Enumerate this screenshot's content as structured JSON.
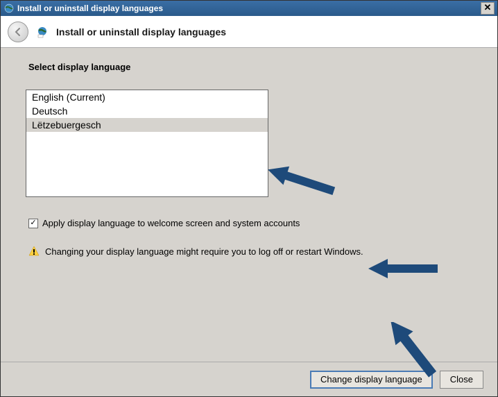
{
  "titlebar": {
    "title": "Install or uninstall display languages"
  },
  "header": {
    "title": "Install or uninstall display languages"
  },
  "content": {
    "section_title": "Select display language",
    "languages": [
      {
        "label": "English (Current)",
        "selected": false
      },
      {
        "label": "Deutsch",
        "selected": false
      },
      {
        "label": "Lëtzebuergesch",
        "selected": true
      }
    ],
    "checkbox_label": "Apply display language to welcome screen and system accounts",
    "checkbox_checked": true,
    "warning_text": "Changing your display language might require you to log off or restart Windows."
  },
  "footer": {
    "primary_button": "Change display language",
    "close_button": "Close"
  },
  "colors": {
    "arrow": "#1e4a7a"
  }
}
